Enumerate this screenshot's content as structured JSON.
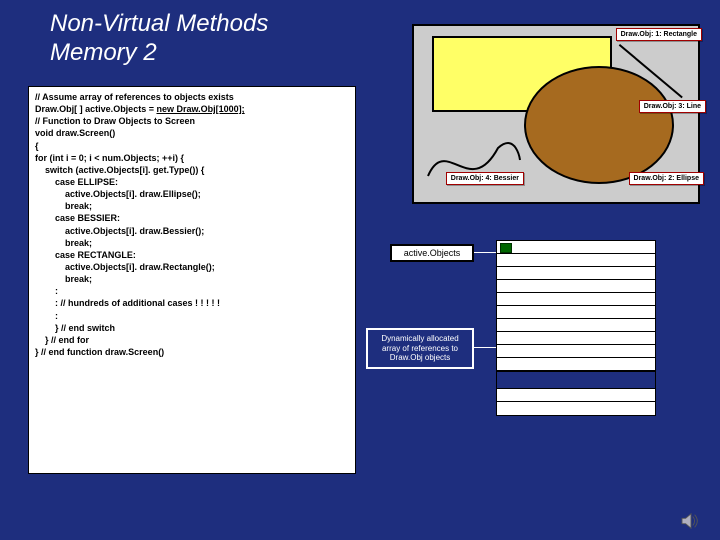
{
  "title": {
    "line1": "Non-Virtual Methods",
    "line2": "Memory 2"
  },
  "code": {
    "l01": "// Assume array of references to objects exists",
    "l02a": "Draw.Obj[ ] active.Objects = ",
    "l02b": "new Draw.Obj[1000];",
    "l03": "// Function to Draw Objects to Screen",
    "l04": "void draw.Screen()",
    "l05": "{",
    "l06": "for (int i = 0; i < num.Objects; ++i) {",
    "l07": "switch (active.Objects[i]. get.Type()) {",
    "l08": "case ELLIPSE:",
    "l09": "active.Objects[i]. draw.Ellipse();",
    "l10": "break;",
    "l11": "case BESSIER:",
    "l12": "active.Objects[i]. draw.Bessier();",
    "l13": "break;",
    "l14": "case RECTANGLE:",
    "l15": "active.Objects[i]. draw.Rectangle();",
    "l16": "break;",
    "l17": ":",
    "l18": ":   // hundreds of additional cases ! ! ! ! !",
    "l19": ":",
    "l20": "}   // end switch",
    "l21": "}  // end for",
    "l22": "} // end function draw.Screen()"
  },
  "scene_labels": {
    "rect": "Draw.Obj: 1: Rectangle",
    "line": "Draw.Obj: 3: Line",
    "ellipse": "Draw.Obj: 2: Ellipse",
    "bessier": "Draw.Obj: 4: Bessier"
  },
  "ao": "active.Objects",
  "dyn": "Dynamically allocated array of references to Draw.Obj objects",
  "colors": {
    "slideBg": "#1e2e7e",
    "rectFill": "#ffff66",
    "ellipseFill": "#a66a1f",
    "labelBorder": "#a00000",
    "arrayItem": "#006600"
  }
}
